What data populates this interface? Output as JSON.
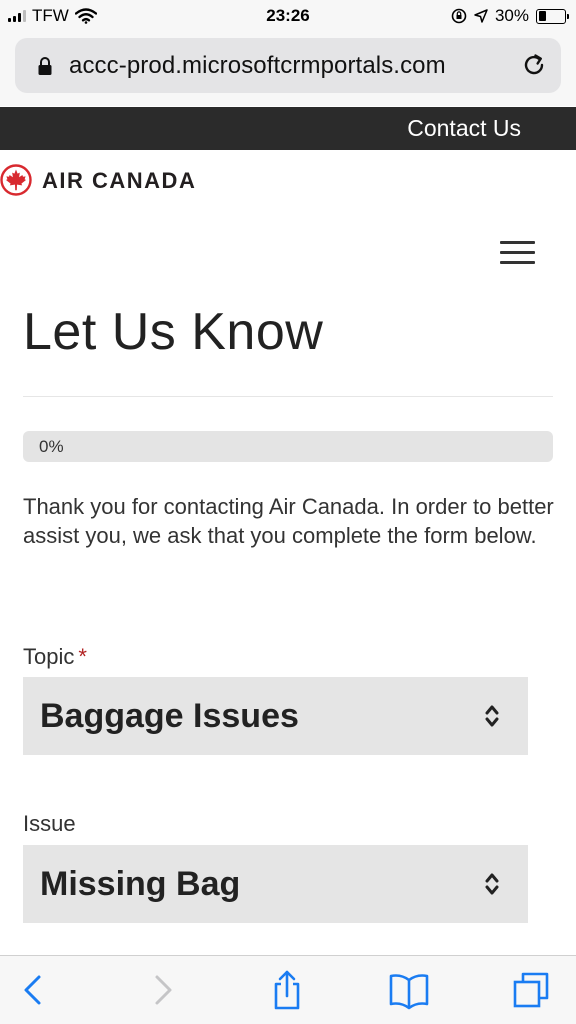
{
  "status_bar": {
    "carrier": "TFW",
    "time": "23:26",
    "battery": "30%",
    "battery_level": 0.3
  },
  "browser": {
    "url": "accc-prod.microsoftcrmportals.com"
  },
  "top_strip": {
    "contact_label": "Contact Us"
  },
  "brand": {
    "name": "AIR CANADA",
    "accent_color": "#d8292f"
  },
  "page": {
    "title": "Let Us Know",
    "progress_label": "0%",
    "progress_value": 0,
    "intro": "Thank you for contacting Air Canada. In order to better assist you, we ask that you complete the form below."
  },
  "form": {
    "topic": {
      "label": "Topic",
      "required_mark": "*",
      "value": "Baggage Issues"
    },
    "issue": {
      "label": "Issue",
      "value": "Missing Bag"
    }
  },
  "toolbar": {
    "icons": [
      "back-icon",
      "forward-icon",
      "share-icon",
      "bookmarks-icon",
      "tabs-icon"
    ],
    "tint": "#1a7cf2"
  }
}
